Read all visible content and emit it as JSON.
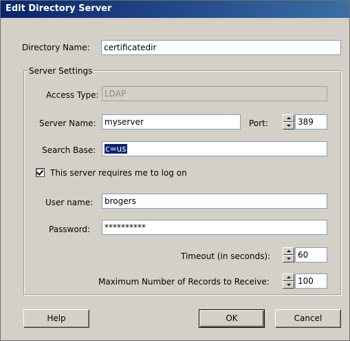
{
  "window": {
    "title": "Edit Directory Server"
  },
  "directory_name": {
    "label": "Directory Name:",
    "value": "certificatedir"
  },
  "server_settings": {
    "legend": "Server Settings",
    "access_type": {
      "label": "Access Type:",
      "value": "LDAP"
    },
    "server_name": {
      "label": "Server Name:",
      "value": "myserver"
    },
    "port": {
      "label": "Port:",
      "value": "389"
    },
    "search_base": {
      "label": "Search Base:",
      "value": "c=us"
    },
    "requires_logon": {
      "label": "This server requires me to log on",
      "checked": true
    },
    "user_name": {
      "label": "User name:",
      "value": "brogers"
    },
    "password": {
      "label": "Password:",
      "value": "**********"
    },
    "timeout": {
      "label": "Timeout (in seconds):",
      "value": "60"
    },
    "max_records": {
      "label": "Maximum Number of Records to Receive:",
      "value": "100"
    }
  },
  "buttons": {
    "help": "Help",
    "ok": "OK",
    "cancel": "Cancel"
  },
  "colors": {
    "titlebar_start": "#0a246a",
    "titlebar_end": "#3a6ea5",
    "dialog_bg": "#d4d0c8",
    "selection": "#0a246a"
  }
}
